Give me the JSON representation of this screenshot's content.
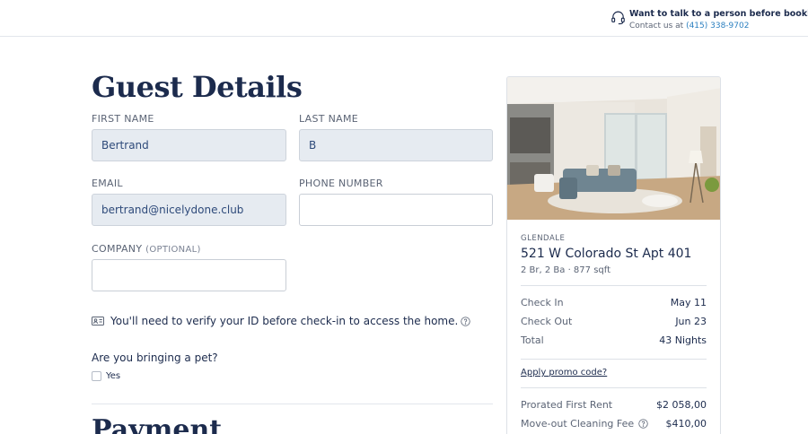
{
  "header": {
    "help_title": "Want to talk to a person before booking?",
    "help_prefix": "Contact us at",
    "help_phone": "(415) 338-9702"
  },
  "guest": {
    "title": "Guest Details",
    "first_name_label": "FIRST NAME",
    "first_name_value": "Bertrand",
    "last_name_label": "LAST NAME",
    "last_name_value": "B",
    "email_label": "EMAIL",
    "email_value": "bertrand@nicelydone.club",
    "phone_label": "PHONE NUMBER",
    "phone_value": "",
    "company_label": "COMPANY",
    "company_optional": "(OPTIONAL)",
    "company_value": ""
  },
  "verify_text": "You'll need to verify your ID before check-in to access the home.",
  "pet": {
    "question": "Are you bringing a pet?",
    "option_yes": "Yes"
  },
  "payment_title": "Payment",
  "listing": {
    "city": "GLENDALE",
    "address": "521 W Colorado St Apt 401",
    "specs": "2 Br, 2 Ba · 877 sqft",
    "check_in_label": "Check In",
    "check_in_value": "May 11",
    "check_out_label": "Check Out",
    "check_out_value": "Jun 23",
    "total_label": "Total",
    "total_value": "43 Nights",
    "promo": "Apply promo code?",
    "prorated_label": "Prorated First Rent",
    "prorated_value": "$2 058,00",
    "cleaning_label": "Move-out Cleaning Fee",
    "cleaning_value": "$410,00"
  },
  "icons": [
    "headset-icon",
    "id-card-icon",
    "info-icon"
  ],
  "colors": {
    "text": "#1c2b4d",
    "link": "#2c80c0",
    "input_filled": "#e6ebf1"
  }
}
